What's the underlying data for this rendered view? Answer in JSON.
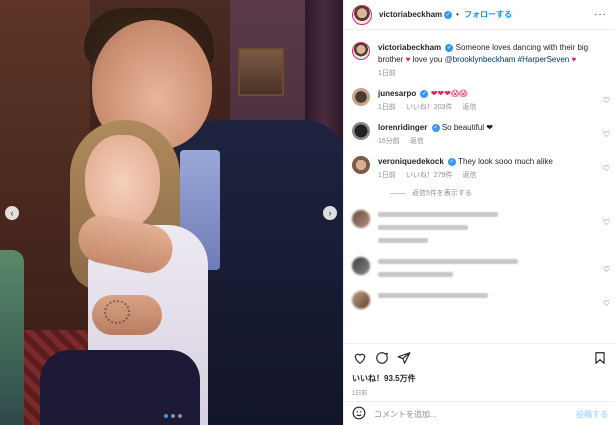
{
  "post": {
    "username": "victoriabeckham",
    "follow_label": "フォローする",
    "menu_icon": "more-dots-icon",
    "caption": {
      "text": "Someone loves dancing with their big brother",
      "text2": "love you",
      "mention1": "@brooklynbeckham",
      "tag": "#HarperSeven",
      "time": "1日前"
    },
    "comments": [
      {
        "user": "junesarpo",
        "text": "❤❤❤😱😱",
        "time": "1日前",
        "likes": "いいね！203件",
        "reply": "返信"
      },
      {
        "user": "lorenridinger",
        "text": "So beautiful ❤",
        "time": "16分前",
        "likes": "",
        "reply": "返信"
      },
      {
        "user": "veroniquedekock",
        "text": "They look sooo much alike",
        "time": "1日前",
        "likes": "いいね！279件",
        "reply": "返信"
      }
    ],
    "view_replies": "返信5件を表示する",
    "like_count": "いいね！93.5万件",
    "date": "1日前",
    "comment_placeholder": "コメントを追加...",
    "post_label": "投稿する"
  },
  "icons": {
    "like": "heart-icon",
    "comment": "comment-icon",
    "share": "share-icon",
    "save": "bookmark-icon",
    "emoji": "emoji-icon",
    "prev": "chevron-left-icon",
    "next": "chevron-right-icon"
  },
  "colors": {
    "link": "#00376b",
    "follow": "#0095f6",
    "verified": "#3897f0",
    "muted": "#8e8e8e"
  },
  "carousel": {
    "slides": 3,
    "active": 1
  }
}
